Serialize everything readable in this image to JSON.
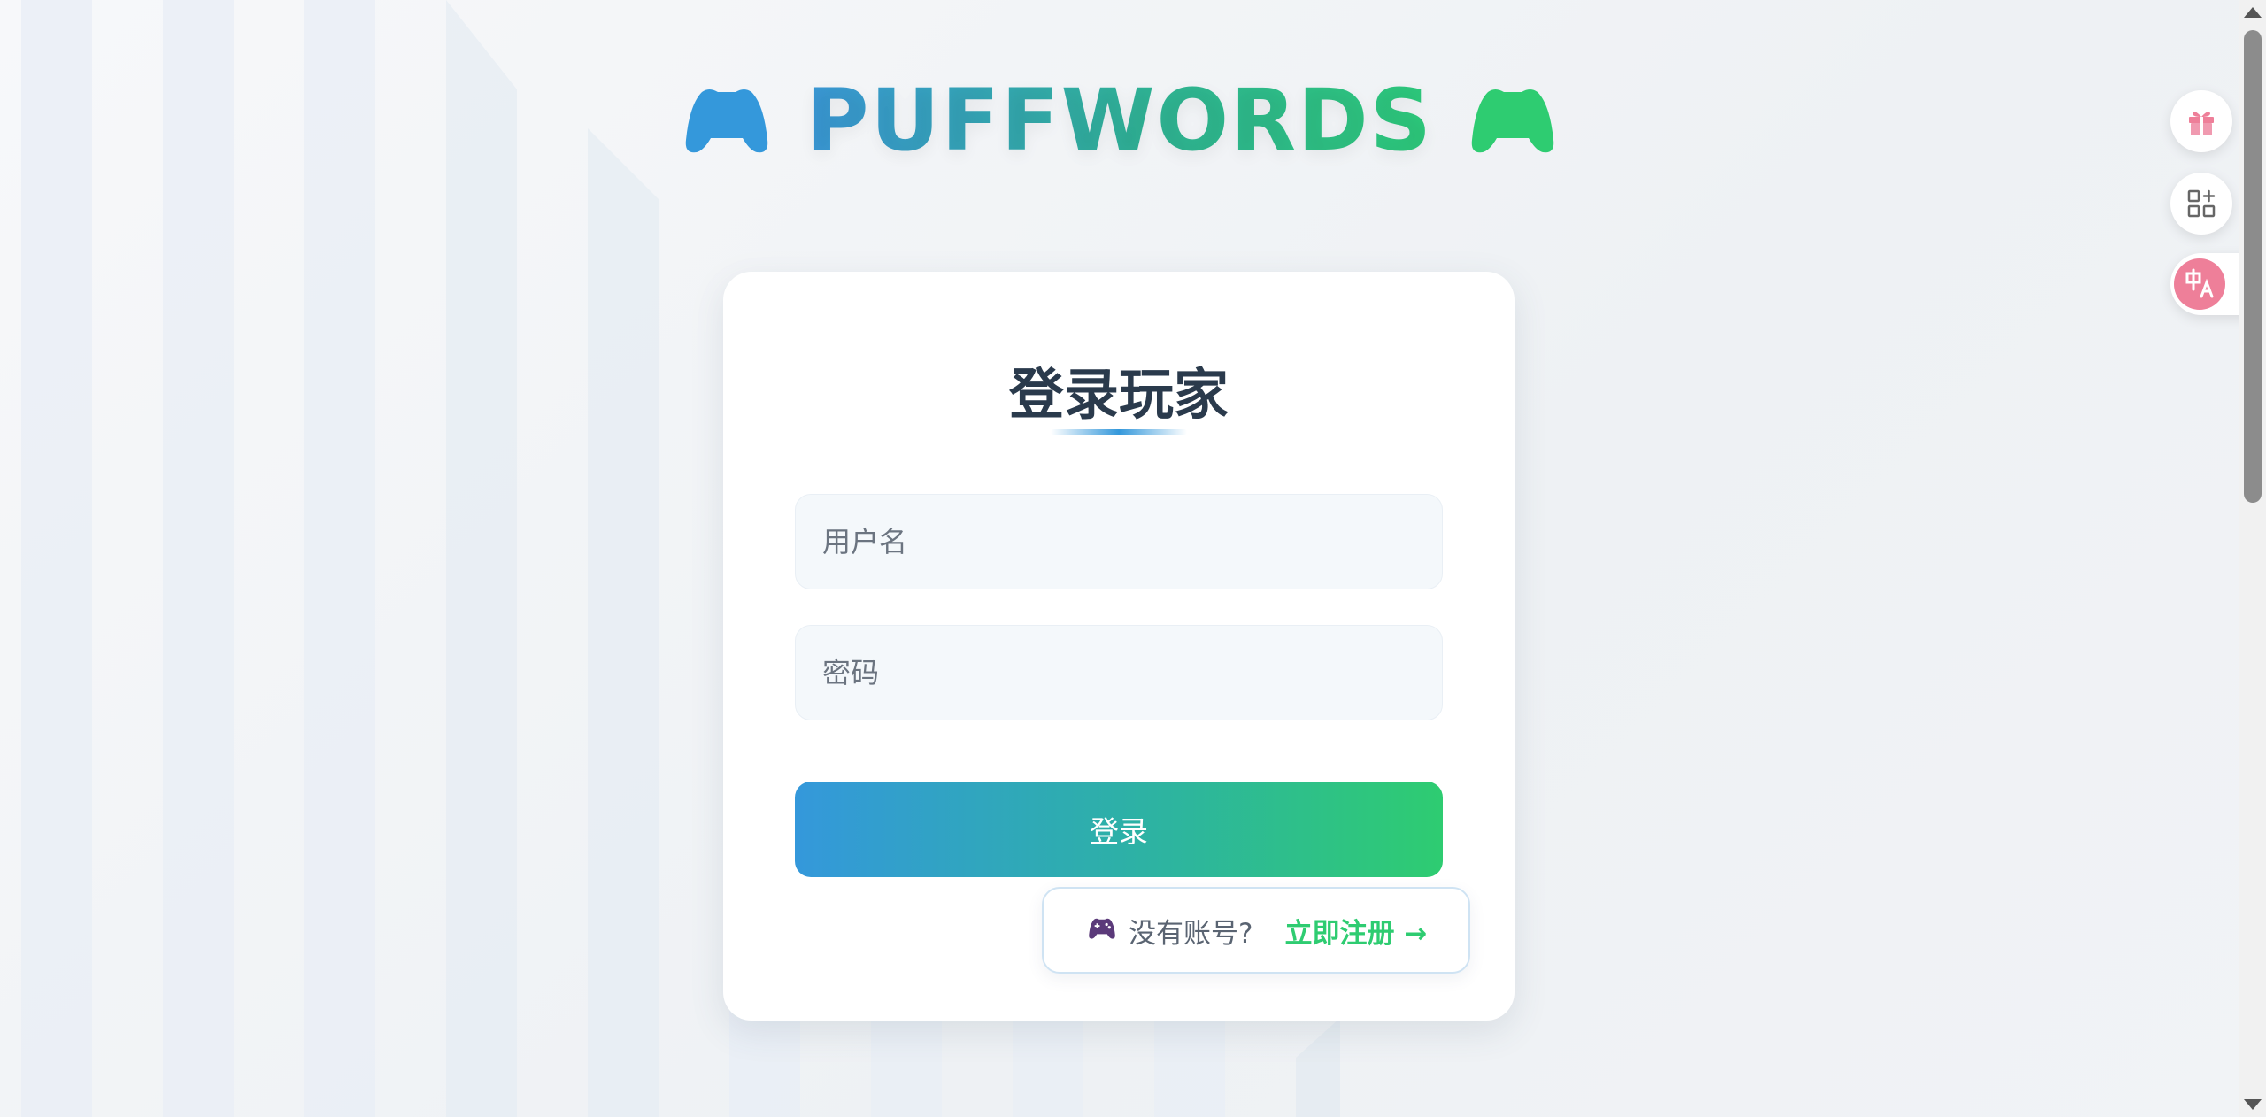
{
  "header": {
    "brand": "PUFFWORDS",
    "left_icon": "gamepad-icon",
    "right_icon": "gamepad-icon",
    "colors": {
      "blue": "#3498db",
      "green": "#2ecc71"
    }
  },
  "login_card": {
    "title": "登录玩家",
    "username_placeholder": "用户名",
    "password_placeholder": "密码",
    "login_button": "登录"
  },
  "register": {
    "icon": "gamepad-icon",
    "prompt": "没有账号?",
    "link": "立即注册 →"
  },
  "side_tools": [
    {
      "icon": "gift-icon"
    },
    {
      "icon": "apps-add-icon"
    },
    {
      "icon": "translate-icon"
    }
  ]
}
